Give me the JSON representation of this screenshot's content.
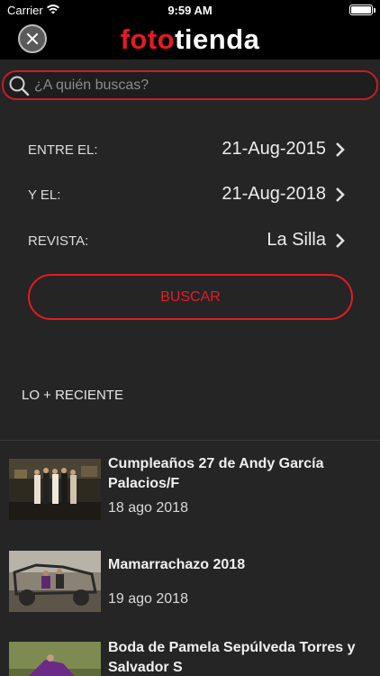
{
  "status_bar": {
    "carrier": "Carrier",
    "time": "9:59 AM"
  },
  "header": {
    "logo_part1": "foto",
    "logo_part2": "tienda"
  },
  "search": {
    "placeholder": "¿A quién buscas?"
  },
  "filters": [
    {
      "label": "ENTRE EL:",
      "value": "21-Aug-2015"
    },
    {
      "label": "Y EL:",
      "value": "21-Aug-2018"
    },
    {
      "label": "REVISTA:",
      "value": "La Silla"
    }
  ],
  "search_button": "BUSCAR",
  "recent": {
    "title": "LO + RECIENTE",
    "items": [
      {
        "title": "Cumpleaños 27 de Andy García Palacios/F",
        "date": "18 ago 2018"
      },
      {
        "title": "Mamarrachazo 2018",
        "date": "19 ago 2018"
      },
      {
        "title": "Boda de Pamela Sepúlveda Torres y Salvador S",
        "date": ""
      }
    ]
  },
  "colors": {
    "accent": "#e51b25",
    "background": "#252525",
    "bar": "#000000"
  }
}
